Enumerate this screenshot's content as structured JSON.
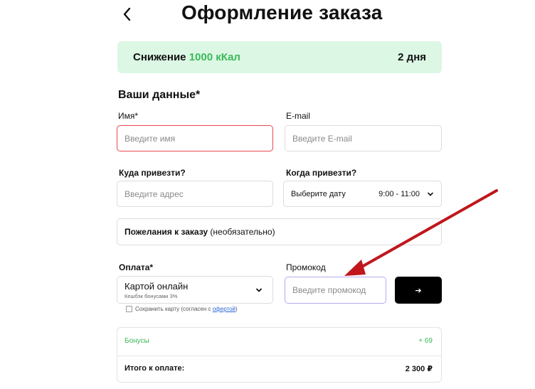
{
  "header": {
    "title": "Оформление заказа"
  },
  "plan": {
    "prefix": "Снижение",
    "calories": "1000 кКал",
    "duration": "2 дня"
  },
  "form": {
    "section_title": "Ваши данные*",
    "name": {
      "label": "Имя*",
      "placeholder": "Введите имя"
    },
    "email": {
      "label": "E-mail",
      "placeholder": "Введите E-mail"
    },
    "address": {
      "label": "Куда привезти?",
      "placeholder": "Введите адрес"
    },
    "delivery": {
      "label": "Когда привезти?",
      "date_placeholder": "Выберите дату",
      "time": "9:00 - 11:00"
    },
    "wishes": {
      "label_bold": "Пожелания к заказу",
      "label_rest": " (необязательно)"
    },
    "payment": {
      "label": "Оплата*",
      "method": "Картой онлайн",
      "cashback": "Кешбэк бонусами 3%"
    },
    "promo": {
      "label": "Промокод",
      "placeholder": "Введите промокод",
      "button_symbol": "➔"
    },
    "save_card": {
      "text": "Сохранить карту (согласен с ",
      "link": "офертой",
      "suffix": ")"
    }
  },
  "summary": {
    "bonus_label": "Бонусы",
    "bonus_value": "+ 69",
    "total_label": "Итого к оплате:",
    "total_value": "2 300 ₽"
  },
  "colors": {
    "accent_green": "#3cb95a",
    "plan_bg": "#dcf7e4",
    "error_red": "#e5484d",
    "annotation_arrow": "#c0161c"
  }
}
